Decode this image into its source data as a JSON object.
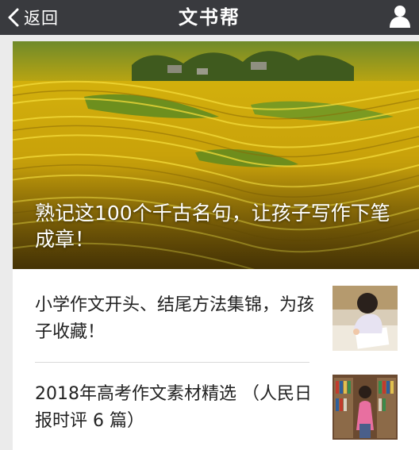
{
  "navbar": {
    "back_label": "返回",
    "back_icon": "chevron-left-icon",
    "title": "文书帮",
    "profile_icon": "user-icon"
  },
  "hero": {
    "caption": "熟记这100个千古名句，让孩子写作下笔成章！",
    "image_subject": "terraced golden rice fields"
  },
  "articles": [
    {
      "title": "小学作文开头、结尾方法集锦，为孩子收藏！",
      "thumbnail": "child writing at desk"
    },
    {
      "title": "2018年高考作文素材精选 （人民日报时评 6 篇）",
      "thumbnail": "girl in library"
    }
  ],
  "colors": {
    "navbar": "#393a3e",
    "page_background": "#ebebeb",
    "card": "#ffffff"
  }
}
